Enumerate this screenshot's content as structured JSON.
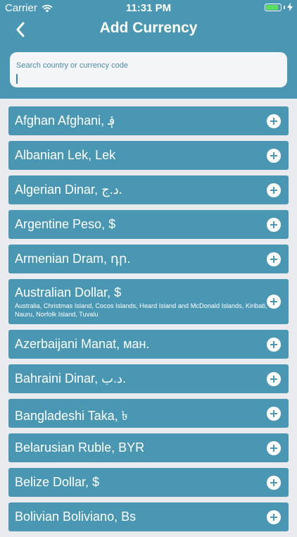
{
  "status_bar": {
    "carrier": "Carrier",
    "time": "11:31 PM",
    "battery_level": 0.9,
    "battery_color": "#5ce05c"
  },
  "nav": {
    "back_icon": "chevron-left-icon",
    "title": "Add Currency"
  },
  "search": {
    "placeholder": "Search country or currency code",
    "value": ""
  },
  "colors": {
    "header": "#4a97b4",
    "row": "#4a97b4",
    "background": "#e9ebee"
  },
  "currencies": [
    {
      "label": "Afghan Afghani, ؋",
      "countries": ""
    },
    {
      "label": "Albanian Lek, Lek",
      "countries": ""
    },
    {
      "label": "Algerian Dinar, د.ج.",
      "countries": ""
    },
    {
      "label": "Argentine Peso, $",
      "countries": ""
    },
    {
      "label": "Armenian Dram, դր.",
      "countries": ""
    },
    {
      "label": "Australian Dollar, $",
      "countries": "Australia, Christmas Island, Cocos Islands, Heard Island and McDonald Islands, Kiribati, Nauru, Norfolk Island, Tuvalu"
    },
    {
      "label": "Azerbaijani Manat, ман.",
      "countries": ""
    },
    {
      "label": "Bahraini Dinar, د.ب.",
      "countries": ""
    },
    {
      "label": "Bangladeshi Taka, ৳",
      "countries": ""
    },
    {
      "label": "Belarusian Ruble, BYR",
      "countries": ""
    },
    {
      "label": "Belize Dollar, $",
      "countries": ""
    },
    {
      "label": "Bolivian Boliviano, Bs",
      "countries": ""
    }
  ]
}
